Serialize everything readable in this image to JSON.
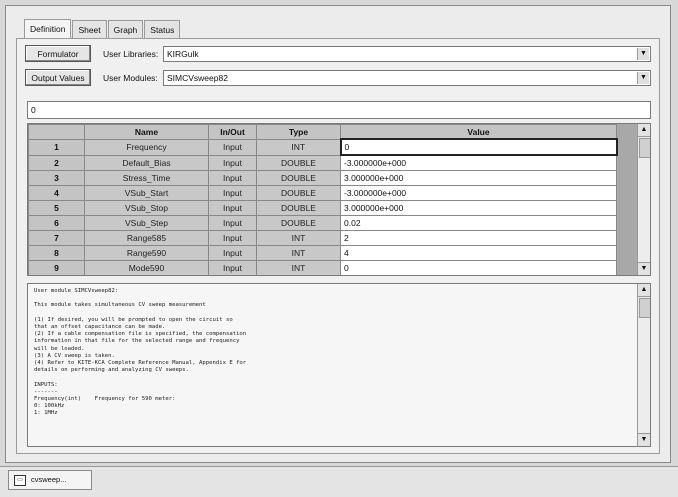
{
  "tabs": [
    "Definition",
    "Sheet",
    "Graph",
    "Status"
  ],
  "active_tab": 0,
  "buttons": {
    "formulator": "Formulator",
    "output_values": "Output Values"
  },
  "user_libraries": {
    "label": "User Libraries:",
    "value": "KIRGulk"
  },
  "user_modules": {
    "label": "User Modules:",
    "value": "SIMCVsweep82"
  },
  "formula_value": "0",
  "grid": {
    "columns": [
      "Name",
      "In/Out",
      "Type",
      "Value"
    ],
    "rows": [
      {
        "num": "1",
        "name": "Frequency",
        "inout": "Input",
        "type": "INT",
        "value": "0"
      },
      {
        "num": "2",
        "name": "Default_Bias",
        "inout": "Input",
        "type": "DOUBLE",
        "value": "-3.000000e+000"
      },
      {
        "num": "3",
        "name": "Stress_Time",
        "inout": "Input",
        "type": "DOUBLE",
        "value": "3.000000e+000"
      },
      {
        "num": "4",
        "name": "VSub_Start",
        "inout": "Input",
        "type": "DOUBLE",
        "value": "-3.000000e+000"
      },
      {
        "num": "5",
        "name": "VSub_Stop",
        "inout": "Input",
        "type": "DOUBLE",
        "value": "3.000000e+000"
      },
      {
        "num": "6",
        "name": "VSub_Step",
        "inout": "Input",
        "type": "DOUBLE",
        "value": "0.02"
      },
      {
        "num": "7",
        "name": "Range585",
        "inout": "Input",
        "type": "INT",
        "value": "2"
      },
      {
        "num": "8",
        "name": "Range590",
        "inout": "Input",
        "type": "INT",
        "value": "4"
      },
      {
        "num": "9",
        "name": "Mode590",
        "inout": "Input",
        "type": "INT",
        "value": "0"
      }
    ]
  },
  "description": [
    "User module SIMCVsweep82:",
    "",
    "This module takes simultaneous CV sweep measurement",
    "",
    "(1) If desired, you will be prompted to open the circuit so",
    "that an offset capacitance can be made.",
    "(2) If a cable compensation file is specified, the compensation",
    "information in that file for the selected range and frequency",
    "will be loaded.",
    "(3) A CV sweep is taken.",
    "(4) Refer to KITE-KCA Complete Reference Manual, Appendix E for",
    "details on performing and analyzing CV sweeps.",
    "",
    "INPUTS:",
    "-------",
    "Frequency(int)    Frequency for 590 meter:",
    "0: 100kHz",
    "1: 1MHz"
  ],
  "window_tab": "cvsweep..."
}
